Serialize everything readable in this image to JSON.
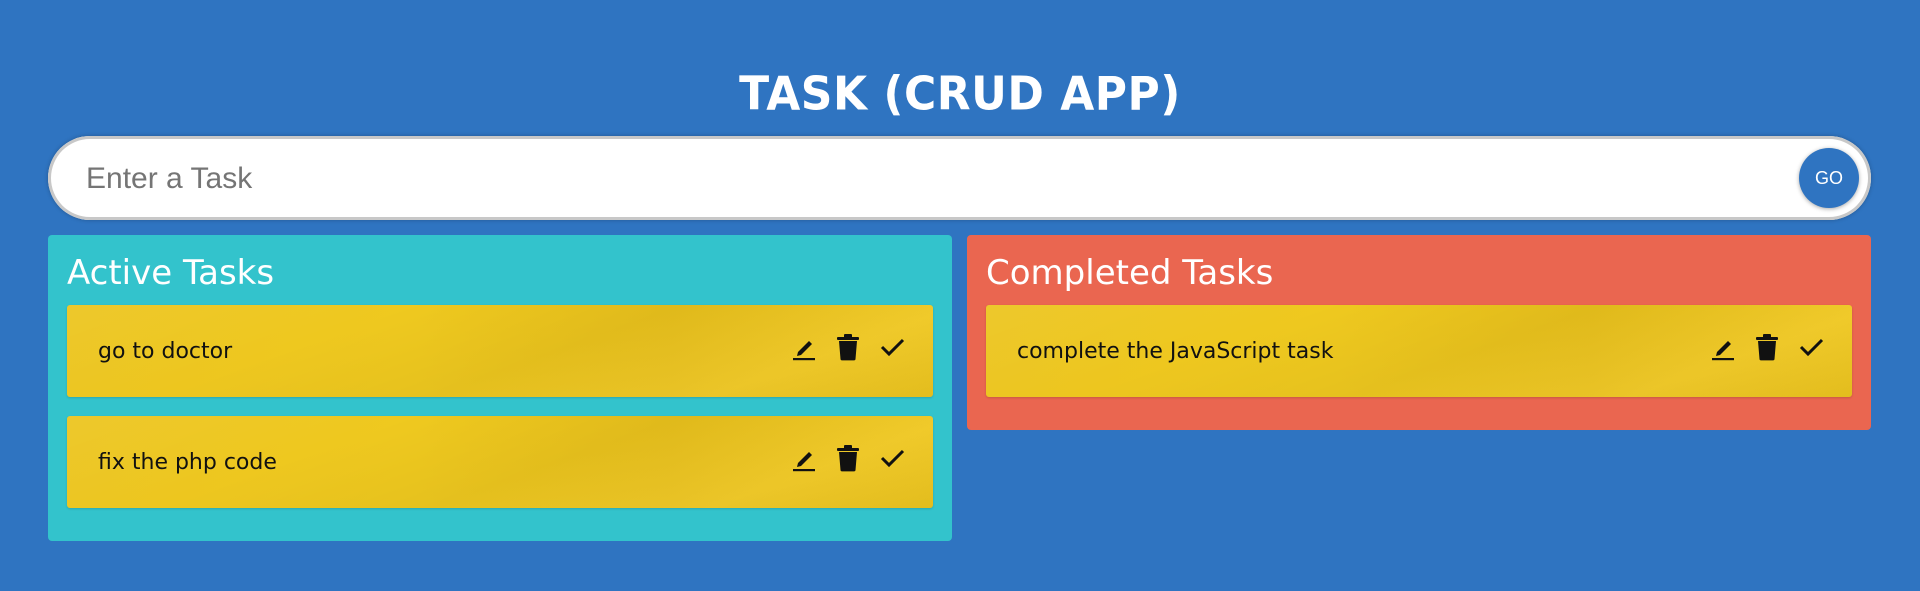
{
  "app": {
    "title": "TASK (CRUD APP)"
  },
  "form": {
    "input_placeholder": "Enter a Task",
    "input_value": "",
    "submit_label": "GO"
  },
  "active_panel": {
    "title": "Active Tasks",
    "tasks": [
      {
        "text": "go to doctor"
      },
      {
        "text": "fix the php code"
      }
    ]
  },
  "completed_panel": {
    "title": "Completed Tasks",
    "tasks": [
      {
        "text": "complete the JavaScript task"
      }
    ]
  },
  "task_actions": {
    "edit_icon": "pencil-edit-icon",
    "delete_icon": "trash-icon",
    "complete_icon": "checkmark-icon"
  },
  "colors": {
    "background": "#2f74c1",
    "active_panel": "#33c3cc",
    "completed_panel": "#ea6650",
    "task_card": "#efc91f",
    "go_button": "#2f74c1"
  }
}
